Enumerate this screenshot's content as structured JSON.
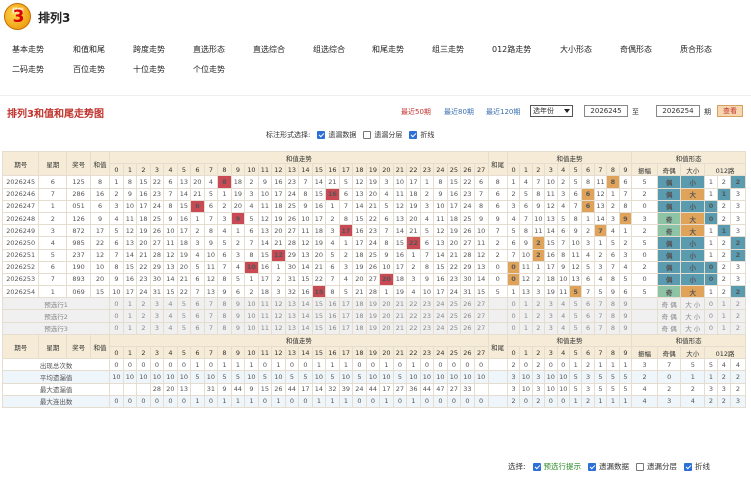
{
  "app": {
    "logo_text": "排列",
    "logo_num": "3",
    "title": "排列3"
  },
  "nav": [
    "基本走势",
    "和值和尾",
    "跨度走势",
    "直选形态",
    "直选综合",
    "组选综合",
    "和尾走势",
    "组三走势",
    "012路走势",
    "大小形态",
    "奇偶形态",
    "质合形态",
    "二码走势",
    "百位走势",
    "十位走势",
    "个位走势"
  ],
  "panel": {
    "title": "排列3和值和尾走势图",
    "recent50": "最近50期",
    "recent80": "最近80期",
    "recent120": "最近120期",
    "select_label": "选年份",
    "from_issue": "2026245",
    "to_label": "至",
    "to_issue": "2026254",
    "issue_unit": "期",
    "query_label": "查看"
  },
  "options": {
    "label": "标注形式选择:",
    "items": [
      {
        "label": "遗漏数据",
        "checked": true
      },
      {
        "label": "遗漏分层",
        "checked": false
      },
      {
        "label": "折线",
        "checked": true
      }
    ]
  },
  "table": {
    "headers": {
      "issue": "期号",
      "week": "星期",
      "prize": "奖号",
      "sum": "和值",
      "sum_trend": "和值走势",
      "tail": "和尾",
      "tail_trend": "和值走势",
      "form": "和值形态",
      "form_switch": "[切换]",
      "span": "振幅",
      "oddeven": "奇偶",
      "size": "大小",
      "road": "012路"
    },
    "sum_cols": [
      "0",
      "1",
      "2",
      "3",
      "4",
      "5",
      "6",
      "7",
      "8",
      "9",
      "10",
      "11",
      "12",
      "13",
      "14",
      "15",
      "16",
      "17",
      "18",
      "19",
      "20",
      "21",
      "22",
      "23",
      "24",
      "25",
      "26",
      "27"
    ],
    "tail_cols": [
      "0",
      "1",
      "2",
      "3",
      "4",
      "5",
      "6",
      "7",
      "8",
      "9"
    ],
    "rows": [
      {
        "issue": "2026245",
        "week": "6",
        "prize": "125",
        "sum": "8",
        "tail": "8",
        "span": "5",
        "oe": "偶",
        "size": "小",
        "road": "2"
      },
      {
        "issue": "2026246",
        "week": "7",
        "prize": "286",
        "sum": "16",
        "tail": "6",
        "span": "2",
        "oe": "偶",
        "size": "大",
        "road": "1"
      },
      {
        "issue": "2026247",
        "week": "1",
        "prize": "051",
        "sug": "",
        "sum": "6",
        "tail": "6",
        "span": "0",
        "oe": "偶",
        "size": "小",
        "road": "0"
      },
      {
        "issue": "2026248",
        "week": "2",
        "prize": "126",
        "sum": "9",
        "tail": "9",
        "span": "3",
        "oe": "奇",
        "size": "大",
        "road": "0"
      },
      {
        "issue": "2026249",
        "week": "3",
        "prize": "872",
        "sum": "17",
        "tail": "7",
        "span": "2",
        "oe": "奇",
        "size": "大",
        "road": "1"
      },
      {
        "issue": "2026250",
        "week": "4",
        "prize": "985",
        "sum": "22",
        "tail": "2",
        "span": "5",
        "oe": "偶",
        "size": "小",
        "road": "2"
      },
      {
        "issue": "2026251",
        "week": "5",
        "prize": "237",
        "sum": "12",
        "tail": "2",
        "span": "0",
        "oe": "偶",
        "size": "小",
        "road": "2"
      },
      {
        "issue": "2026252",
        "week": "6",
        "prize": "190",
        "sum": "10",
        "tail": "0",
        "span": "2",
        "oe": "偶",
        "size": "小",
        "road": "0"
      },
      {
        "issue": "2026253",
        "week": "7",
        "prize": "893",
        "sum": "20",
        "tail": "0",
        "span": "0",
        "oe": "偶",
        "size": "小",
        "road": "0"
      },
      {
        "issue": "2026254",
        "week": "1",
        "prize": "069",
        "sum": "15",
        "tail": "5",
        "span": "5",
        "oe": "奇",
        "size": "大",
        "road": "2"
      }
    ],
    "pre_rows": [
      "预选行1",
      "预选行2",
      "预选行3"
    ],
    "pre_form": [
      "奇",
      "偶",
      "大",
      "小",
      "0",
      "1",
      "2"
    ],
    "stat_rows": [
      {
        "label": "出现总次数",
        "sum": [
          "0",
          "0",
          "0",
          "0",
          "0",
          "0",
          "1",
          "0",
          "1",
          "1",
          "1",
          "0",
          "1",
          "0",
          "0",
          "1",
          "1",
          "1",
          "0",
          "0",
          "1",
          "0",
          "1",
          "0",
          "0",
          "0",
          "0",
          "0"
        ],
        "tail": [
          "2",
          "0",
          "2",
          "0",
          "0",
          "1",
          "2",
          "1",
          "1",
          "1"
        ],
        "form": [
          "3",
          "7",
          "5",
          "5",
          "4",
          "4"
        ]
      },
      {
        "label": "平均遗漏值",
        "sum": [
          "10",
          "10",
          "10",
          "10",
          "10",
          "10",
          "5",
          "10",
          "5",
          "5",
          "10",
          "5",
          "10",
          "5",
          "5",
          "10",
          "5",
          "10",
          "5",
          "10",
          "10",
          "5",
          "10",
          "10",
          "10",
          "10",
          "10",
          "10"
        ],
        "tail": [
          "3",
          "10",
          "3",
          "10",
          "10",
          "5",
          "3",
          "5",
          "5",
          "5"
        ],
        "form": [
          "2",
          "0",
          "1",
          "1",
          "2",
          "2"
        ]
      },
      {
        "label": "最大遗漏值",
        "sum": [
          "",
          "",
          "",
          "28",
          "20",
          "13",
          "",
          "31",
          "9",
          "44",
          "9",
          "15",
          "26",
          "44",
          "17",
          "14",
          "32",
          "39",
          "24",
          "44",
          "17",
          "27",
          "36",
          "44",
          "47",
          "27",
          "33",
          ""
        ],
        "tail": [
          "3",
          "10",
          "3",
          "10",
          "10",
          "5",
          "3",
          "5",
          "5",
          "5"
        ],
        "form": [
          "4",
          "2",
          "2",
          "3",
          "3",
          "2"
        ]
      },
      {
        "label": "最大连出数",
        "sum": [
          "0",
          "0",
          "0",
          "0",
          "0",
          "0",
          "1",
          "0",
          "1",
          "1",
          "1",
          "0",
          "1",
          "0",
          "0",
          "1",
          "1",
          "1",
          "0",
          "0",
          "1",
          "0",
          "1",
          "0",
          "0",
          "0",
          "0",
          "0"
        ],
        "tail": [
          "2",
          "0",
          "2",
          "0",
          "0",
          "1",
          "2",
          "1",
          "1",
          "1"
        ],
        "form": [
          "4",
          "3",
          "4",
          "2",
          "2",
          "3"
        ]
      }
    ]
  },
  "bottom": {
    "label": "选择:",
    "items": [
      {
        "label": "预选行提示",
        "checked": true
      },
      {
        "label": "遗漏数据",
        "checked": true
      },
      {
        "label": "遗漏分层",
        "checked": false
      },
      {
        "label": "折线",
        "checked": true
      }
    ]
  }
}
